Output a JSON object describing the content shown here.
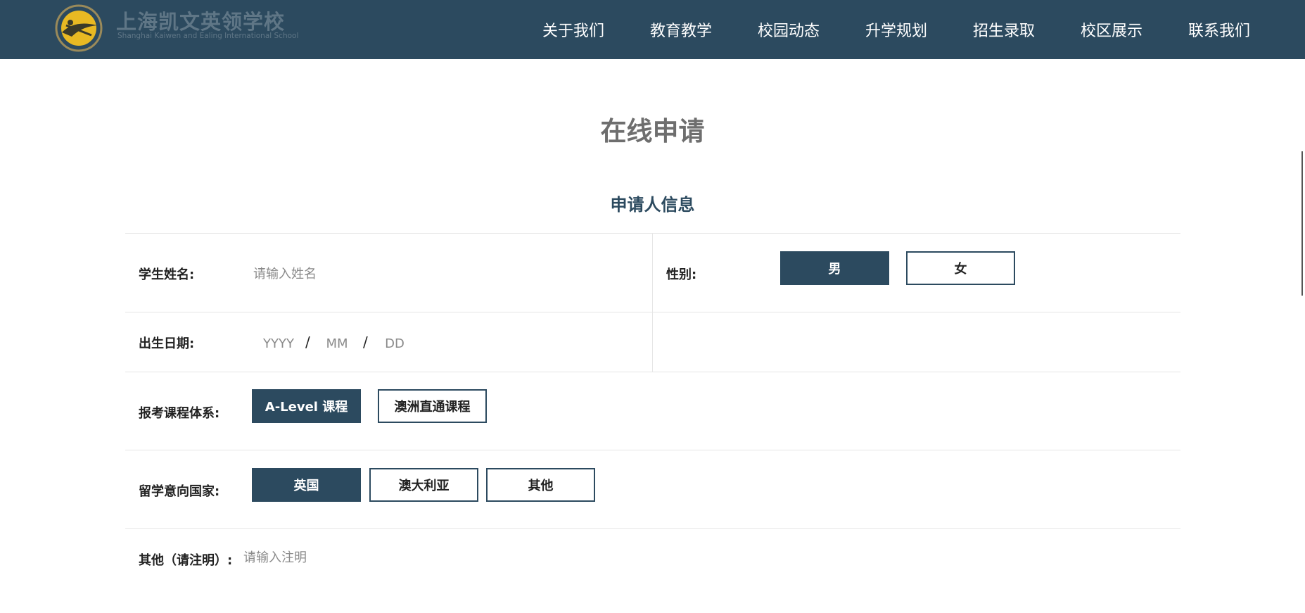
{
  "header": {
    "brand_cn": "上海凯文英领学校",
    "brand_en": "Shanghai Kaiwen and Ealing International School",
    "nav": [
      "关于我们",
      "教育教学",
      "校园动态",
      "升学规划",
      "招生录取",
      "校区展示",
      "联系我们"
    ]
  },
  "page_title": "在线申请",
  "section_title": "申请人信息",
  "form": {
    "student_name": {
      "label": "学生姓名:",
      "placeholder": "请输入姓名"
    },
    "gender": {
      "label": "性别:",
      "options": [
        "男",
        "女"
      ],
      "selected": "男"
    },
    "birth_date": {
      "label": "出生日期:",
      "year_placeholder": "YYYY",
      "month_placeholder": "MM",
      "day_placeholder": "DD",
      "separator": "/"
    },
    "curriculum": {
      "label": "报考课程体系:",
      "options": [
        "A-Level 课程",
        "澳洲直通课程"
      ],
      "selected": "A-Level 课程"
    },
    "country": {
      "label": "留学意向国家:",
      "options": [
        "英国",
        "澳大利亚",
        "其他"
      ],
      "selected": "英国"
    },
    "other_note": {
      "label": "其他（请注明）:",
      "placeholder": "请输入注明"
    }
  },
  "colors": {
    "primary": "#2c4a5f",
    "logo_gold": "#e8b923"
  }
}
